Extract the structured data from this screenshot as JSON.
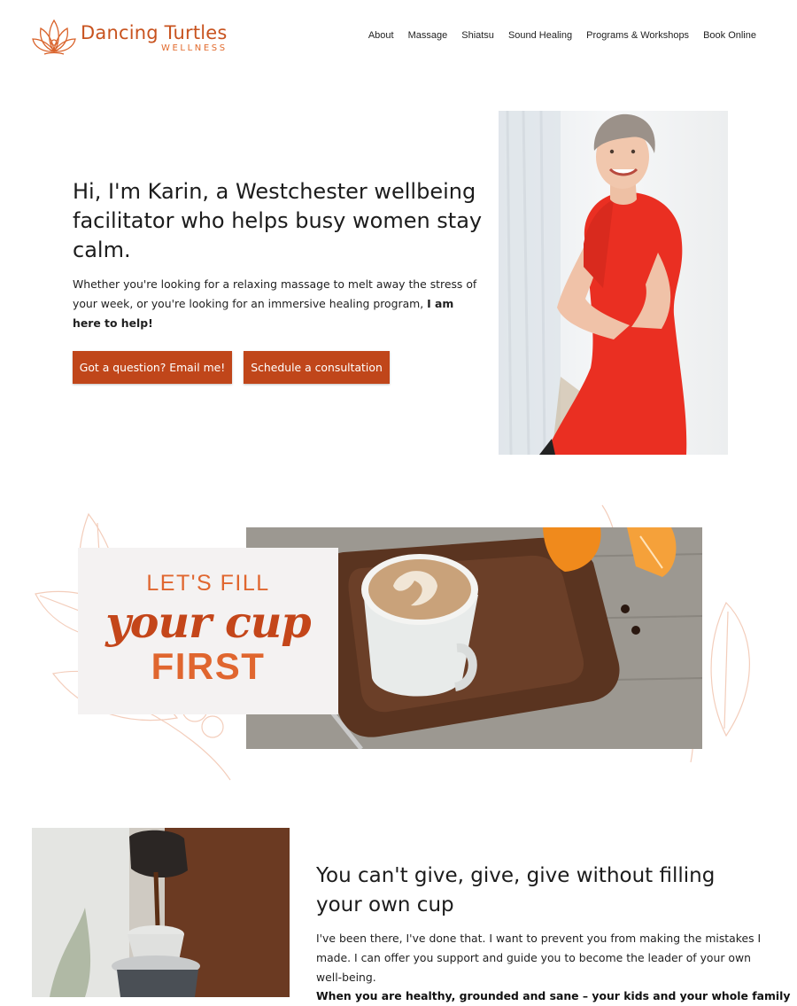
{
  "brand": {
    "name": "Dancing Turtles",
    "tagline": "WELLNESS",
    "logo_icon": "lotus-icon",
    "colors": {
      "brand_orange": "#c8531f",
      "accent_orange": "#e0662f",
      "button": "#c0461a"
    }
  },
  "nav": {
    "items": [
      {
        "label": "About"
      },
      {
        "label": "Massage"
      },
      {
        "label": "Shiatsu"
      },
      {
        "label": "Sound Healing"
      },
      {
        "label": "Programs & Workshops"
      },
      {
        "label": "Book Online"
      }
    ]
  },
  "hero": {
    "title": "Hi, I'm Karin, a Westchester wellbeing facilitator who helps busy women stay calm.",
    "text": "Whether you're looking for a relaxing massage to melt away the stress of your week, or you're looking for an immersive healing program, ",
    "text_bold": "I am here to help!",
    "button_email": "Got a question? Email me!",
    "button_consult": "Schedule a consultation"
  },
  "banner": {
    "line1": "LET'S FILL",
    "line2": "your cup",
    "line3": "FIRST"
  },
  "section": {
    "title": "You can't give, give, give without filling your own cup",
    "text": "I've been there, I've done that. I want to prevent you from making the mistakes I made. I can offer you support and guide you to become the leader of your own well-being.",
    "bold": "When you are healthy, grounded and sane – your kids and your whole family"
  }
}
